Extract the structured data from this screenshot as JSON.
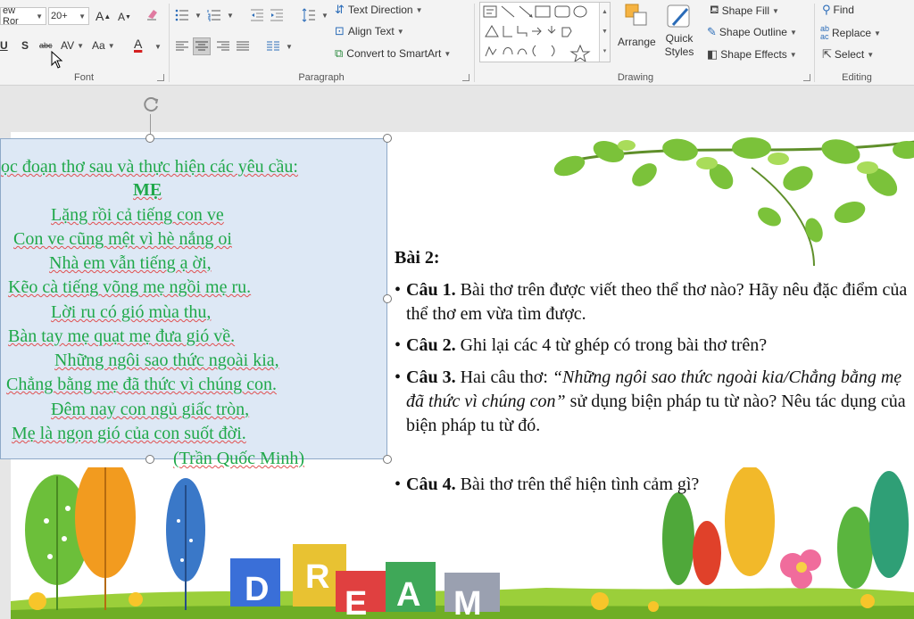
{
  "ribbon": {
    "font": {
      "label": "Font",
      "font_name": "ew Ror",
      "font_size": "20+",
      "grow_font": "A",
      "shrink_font": "A",
      "underline": "U",
      "shadow": "S",
      "strikethrough": "abc",
      "spacing": "AV",
      "change_case": "Aa",
      "font_color_letter": "A"
    },
    "paragraph": {
      "label": "Paragraph",
      "text_direction": "Text Direction",
      "align_text": "Align Text",
      "convert_smartart": "Convert to SmartArt"
    },
    "drawing": {
      "label": "Drawing",
      "arrange": "Arrange",
      "quick_styles_line1": "Quick",
      "quick_styles_line2": "Styles",
      "shape_fill": "Shape Fill",
      "shape_outline": "Shape Outline",
      "shape_effects": "Shape Effects"
    },
    "editing": {
      "label": "Editing",
      "find": "Find",
      "replace": "Replace",
      "select": "Select"
    }
  },
  "slide": {
    "poem": {
      "intro": "ọc đoạn thơ sau và thực hiện các yêu cầu:",
      "title": "MẸ",
      "lines": [
        "Lặng rồi cả tiếng con ve",
        "Con ve cũng mệt vì hè nắng oi",
        "Nhà em vẫn tiếng ạ ời,",
        "Kẽo cà tiếng võng mẹ ngồi mẹ ru.",
        "Lời ru có gió mùa thu,",
        "Bàn tay mẹ quạt mẹ đưa gió về.",
        "Những ngôi sao thức ngoài kia,",
        "Chẳng bằng mẹ đã thức vì chúng con.",
        "Đêm nay con ngủ giấc tròn,",
        "Mẹ là ngọn gió của con suốt đời."
      ],
      "author": "(Trần Quốc Minh)"
    },
    "exercise": {
      "title": "Bài 2:",
      "bullet": "•",
      "questions": [
        {
          "label": "Câu 1.",
          "text": " Bài thơ trên được viết theo thể thơ nào? Hãy nêu đặc điểm của thể thơ em vừa tìm được."
        },
        {
          "label": "Câu 2.",
          "text": " Ghi lại các 4 từ ghép có trong bài thơ trên?"
        },
        {
          "label": "Câu 3.",
          "text_before": " Hai câu thơ: ",
          "quote": "“Những ngôi sao thức ngoài kia/Chẳng bằng mẹ đã thức vì chúng con”",
          "text_after": " sử dụng biện pháp tu từ nào? Nêu tác dụng của biện pháp tu từ đó."
        },
        {
          "label": "Câu 4.",
          "text": " Bài thơ trên thể hiện tình cảm gì?"
        }
      ]
    },
    "decor": {
      "blocks_letters": [
        "D",
        "R",
        "E",
        "A",
        "M"
      ]
    }
  },
  "colors": {
    "poem_text": "#20a84a",
    "poem_box_fill": "#dde8f5",
    "spellcheck": "#e05050",
    "font_color_bar": "#d42020"
  }
}
